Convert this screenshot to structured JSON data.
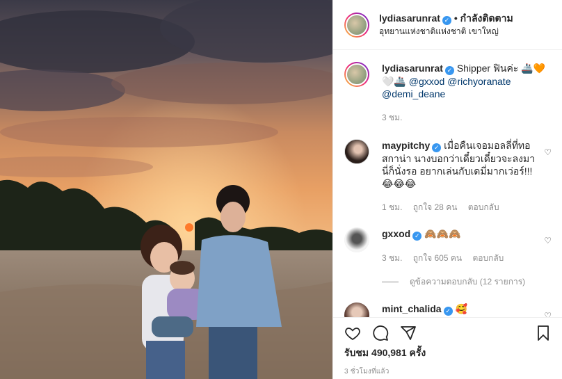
{
  "post": {
    "author": "lydiasarunrat",
    "follow_label": "• กำลังติดตาม",
    "location": "อุทยานแห่งชาติแห่งชาติ เขาใหญ่"
  },
  "caption": {
    "username": "lydiasarunrat",
    "text": " Shipper ฟินค่ะ 🚢🧡",
    "line2_prefix": "🤍🚢 ",
    "mention1": "@gxxod",
    "mention2": "@richyoranate",
    "mention3": "@demi_deane",
    "age": "3 ชม."
  },
  "comments": [
    {
      "username": "maypitchy",
      "text": " เมื่อคืนเจอมอลลี่ที่ทอสกาน่า นางบอกว่าเดี๋ยวเดี๋ยวจะลงมา นี่ก็นั่งรอ อยากเล่นกับเดมี่มากเว่อร์!!! 😂😂😂",
      "age": "1 ชม.",
      "likes": "ถูกใจ 28 คน",
      "reply": "ตอบกลับ"
    },
    {
      "username": "gxxod",
      "text": " 🙈🙈🙈",
      "age": "3 ชม.",
      "likes": "ถูกใจ 605 คน",
      "reply": "ตอบกลับ",
      "view_replies": "ดูข้อความตอบกลับ (12 รายการ)"
    },
    {
      "username": "mint_chalida",
      "text": " 🥰"
    }
  ],
  "footer": {
    "likes": "รับชม 490,981 ครั้ง",
    "time": "3 ชั่วโมงที่แล้ว"
  },
  "icons": {
    "like": "heart-icon",
    "comment": "comment-icon",
    "share": "share-icon",
    "save": "bookmark-icon"
  }
}
